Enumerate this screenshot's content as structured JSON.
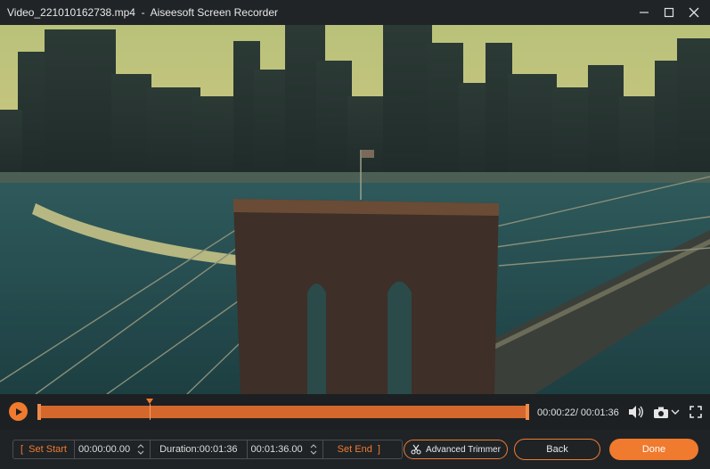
{
  "window": {
    "title": "Video_221010162738.mp4  -  Aiseesoft Screen Recorder"
  },
  "player": {
    "time_display": "00:00:22/ 00:01:36",
    "playhead_fraction": 0.229
  },
  "trim": {
    "set_start_label": "Set Start",
    "start_time": "00:00:00.00",
    "duration": "Duration:00:01:36",
    "end_time": "00:01:36.00",
    "set_end_label": "Set End"
  },
  "buttons": {
    "advanced_trimmer": "Advanced Trimmer",
    "back": "Back",
    "done": "Done"
  },
  "colors": {
    "accent": "#f07a2e",
    "timeline": "#d4682c"
  }
}
